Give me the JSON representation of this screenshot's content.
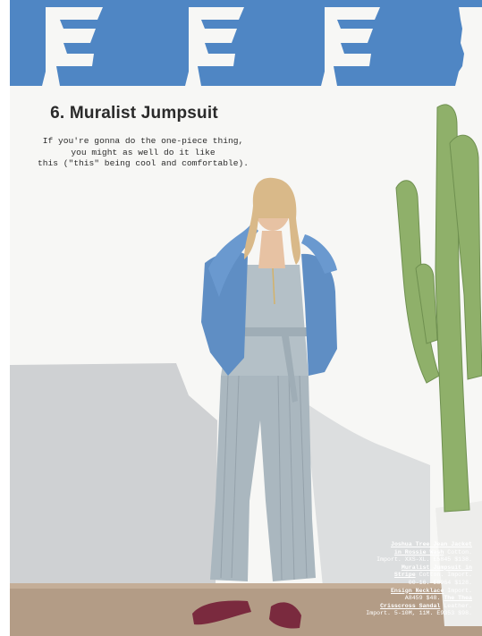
{
  "page": {
    "title": "6. Muralist Jumpsuit",
    "intro_lines": [
      "If you're gonna do the one-piece thing,",
      "you might as well do it like",
      "this (\"this\" being cool and comfortable)."
    ]
  },
  "credits": {
    "item1_name_a": "Joshua Tree Jean Jacket",
    "item1_name_b": "in Rossie Wash",
    "item1_detail_a": "Cotton.",
    "item1_detail_b": "Import. XXS-XL. E5845 $138.",
    "item2_name_a": "Muralist Jumpsuit in",
    "item2_name_b": "Stripe",
    "item2_detail_a": "Cotton. Import.",
    "item2_detail_b": "00-16. E8964 $128.",
    "item3_name": "Ensign Necklace",
    "item3_detail_a": "Import.",
    "item3_detail_b": "A8459 $48.",
    "item4_name_a": "The Thea",
    "item4_name_b": "Crisscross Sandal",
    "item4_detail_a": "Leather.",
    "item4_detail_b": "Import. 5-10M, 11M. E9353 $98."
  },
  "colors": {
    "sky": "#4f86c4",
    "wall": "#f7f7f5",
    "shadow": "#c9cbcd",
    "ground": "#b39c86",
    "cactus": "#8fb06a",
    "denim": "#5f8ec4",
    "jumpsuit": "#aab7bf",
    "sandal": "#7a2a3e",
    "hair": "#d9b989",
    "skin": "#e7c2a3"
  }
}
